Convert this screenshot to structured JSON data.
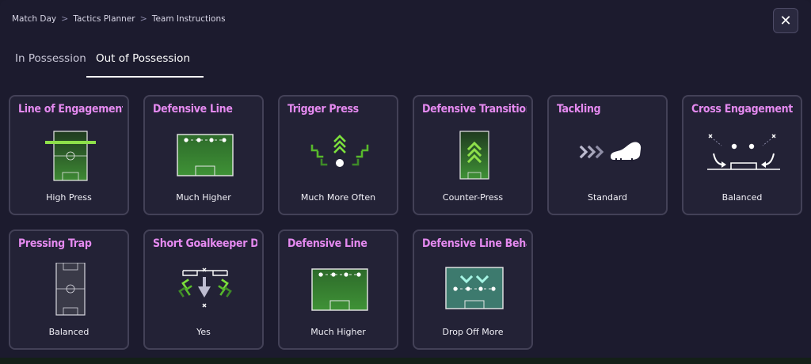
{
  "breadcrumb": {
    "items": [
      "Match Day",
      "Tactics Planner",
      "Team Instructions"
    ],
    "separator": ">"
  },
  "close_button": {
    "glyph": "✕",
    "icon": "close-icon"
  },
  "tabs": [
    {
      "label": "In Possession",
      "active": false
    },
    {
      "label": "Out of Possession",
      "active": true
    }
  ],
  "cards": [
    {
      "title": "Line of Engagement",
      "value": "High Press",
      "icon": "pitch-engagement-line-icon"
    },
    {
      "title": "Defensive Line",
      "value": "Much Higher",
      "icon": "pitch-defensive-line-icon"
    },
    {
      "title": "Trigger Press",
      "value": "Much More Often",
      "icon": "press-chevrons-icon"
    },
    {
      "title": "Defensive Transition",
      "value": "Counter-Press",
      "icon": "counter-press-icon"
    },
    {
      "title": "Tackling",
      "value": "Standard",
      "icon": "boot-tackle-icon"
    },
    {
      "title": "Cross Engagement",
      "value": "Balanced",
      "icon": "cross-engagement-icon"
    },
    {
      "title": "Pressing Trap",
      "value": "Balanced",
      "icon": "pitch-pressing-trap-icon"
    },
    {
      "title": "Short Goalkeeper Distr",
      "value": "Yes",
      "icon": "goalkeeper-distribution-icon"
    },
    {
      "title": "Defensive Line",
      "value": "Much Higher",
      "icon": "pitch-defensive-line-icon"
    },
    {
      "title": "Defensive Line Behavio",
      "value": "Drop Off More",
      "icon": "drop-off-icon"
    }
  ],
  "colors": {
    "accent_title": "#e58af0",
    "pitch_green": "#4caf3a",
    "press_green": "#7ce03c",
    "card_border": "#434157",
    "background": "#1c1b2e"
  }
}
